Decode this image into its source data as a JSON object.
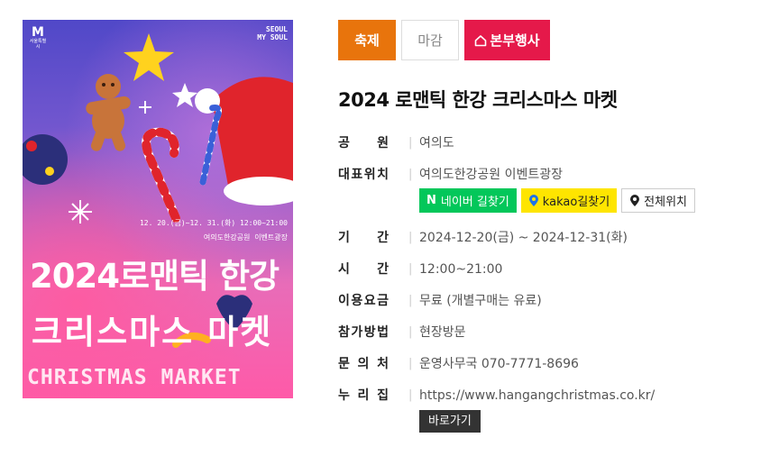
{
  "poster": {
    "logo_mark": "M",
    "logo_sub": "서울특별시",
    "brand_line1": "SEOUL",
    "brand_line2": "MY SOUL",
    "date_line": "12. 20.(금)~12. 31.(화) 12:00~21:00",
    "place_line": "여의도한강공원 이벤트광장",
    "title_line1": "2024로맨틱 한강",
    "title_line2": "크리스마스 마켓",
    "title_en": "CHRISTMAS MARKET",
    "colors": {
      "top": "#5048c8",
      "bottom": "#ff5aa8"
    }
  },
  "tags": {
    "festival": "축제",
    "closed": "마감",
    "hq_event": "본부행사",
    "colors": {
      "festival": "#e8740c",
      "hq_event": "#e5194a"
    }
  },
  "event": {
    "title": "2024 로맨틱 한강 크리스마스 마켓"
  },
  "info": {
    "park": {
      "label_chars": [
        "공",
        "원"
      ],
      "value": "여의도"
    },
    "location": {
      "label_chars": [
        "대",
        "표",
        "위",
        "치"
      ],
      "value": "여의도한강공원 이벤트광장",
      "buttons": {
        "naver_icon": "N",
        "naver": "네이버 길찾기",
        "kakao": "kakao길찾기",
        "all": "전체위치"
      }
    },
    "period": {
      "label_chars": [
        "기",
        "간"
      ],
      "value": "2024-12-20(금) ~ 2024-12-31(화)"
    },
    "time": {
      "label_chars": [
        "시",
        "간"
      ],
      "value": "12:00~21:00"
    },
    "fee": {
      "label_chars": [
        "이",
        "용",
        "요",
        "금"
      ],
      "value": "무료 (개별구매는 유료)"
    },
    "method": {
      "label_chars": [
        "참",
        "가",
        "방",
        "법"
      ],
      "value": "현장방문"
    },
    "contact": {
      "label_chars": [
        "문",
        "의",
        "처"
      ],
      "value": "운영사무국 070-7771-8696"
    },
    "website": {
      "label_chars": [
        "누",
        "리",
        "집"
      ],
      "value": "https://www.hangangchristmas.co.kr/",
      "go_button": "바로가기"
    }
  }
}
